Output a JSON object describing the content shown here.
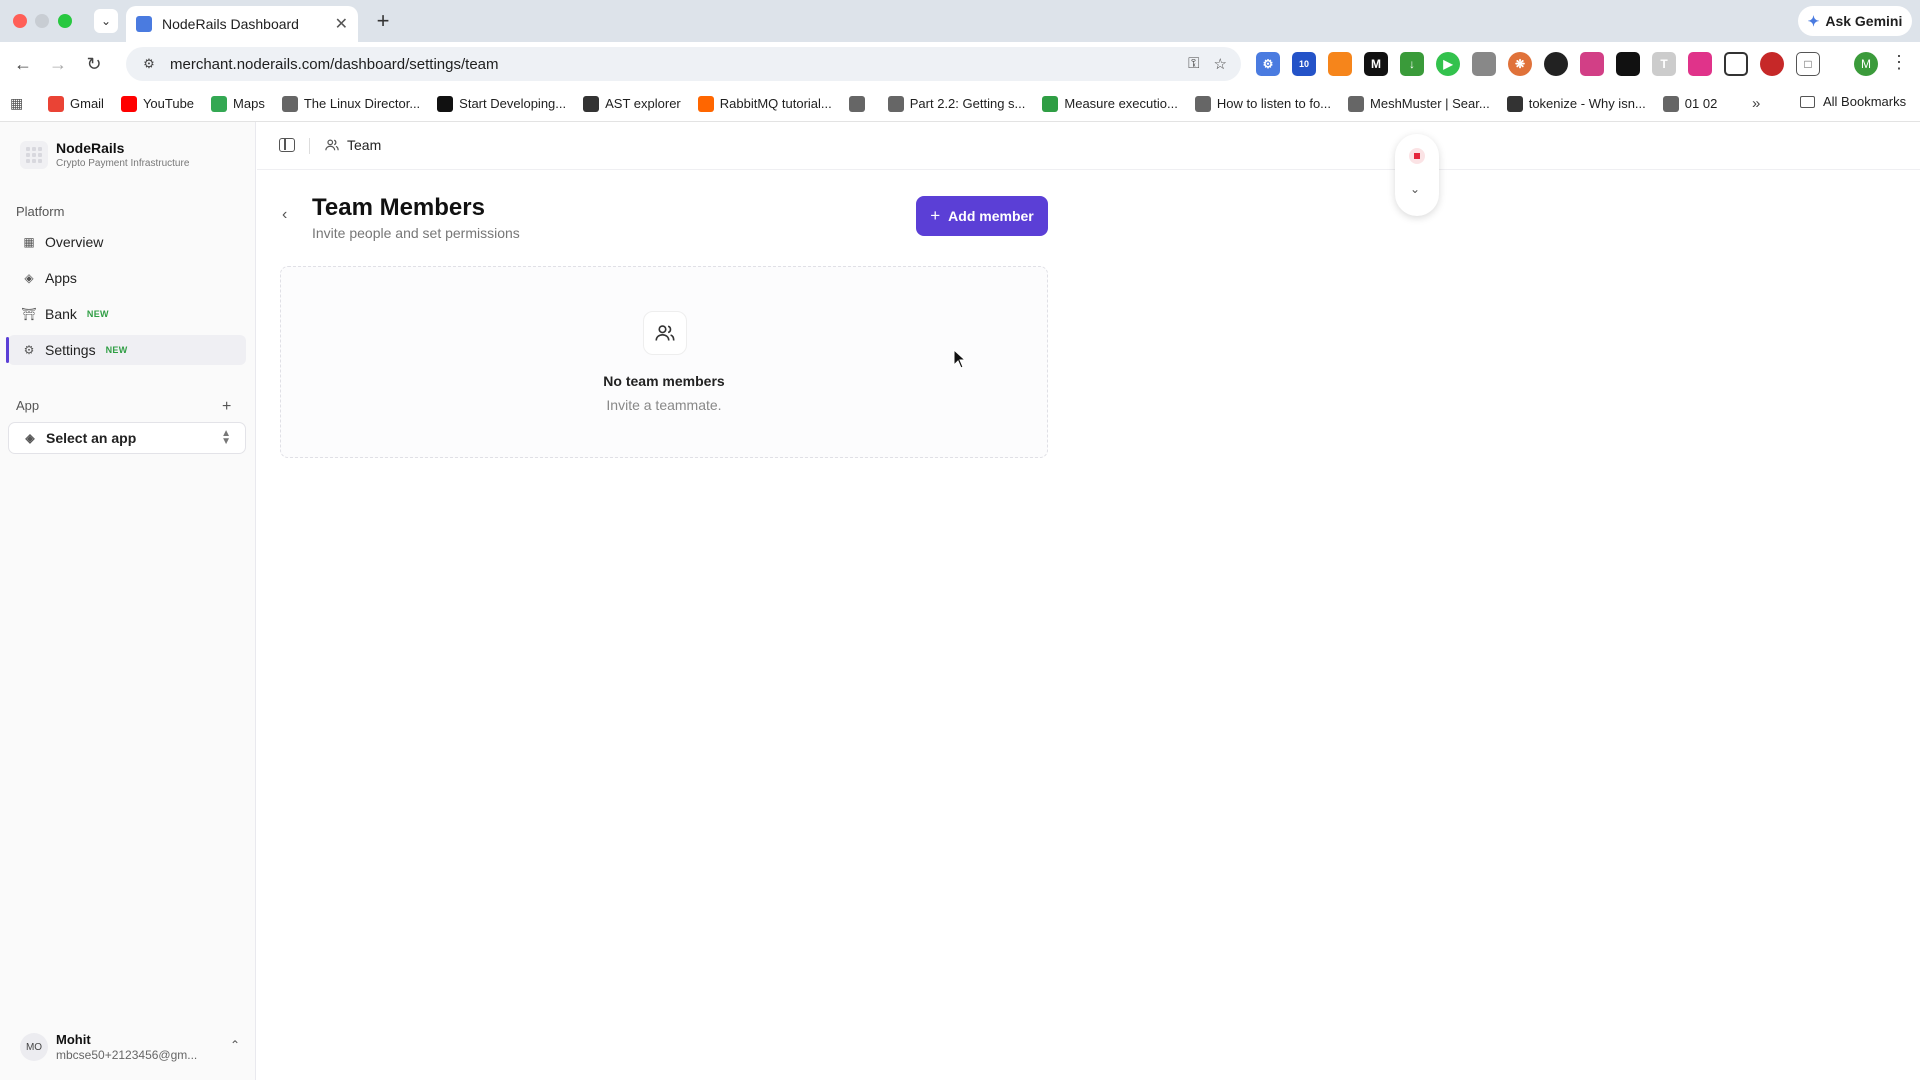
{
  "browser": {
    "tab_title": "NodeRails Dashboard",
    "url": "merchant.noderails.com/dashboard/settings/team",
    "gemini_label": "Ask Gemini",
    "profile_initial": "M",
    "ext_badge": "10",
    "bookmarks": [
      {
        "label": "Gmail",
        "icon": "gmail-icon",
        "color": "#ea4335"
      },
      {
        "label": "YouTube",
        "icon": "youtube-icon",
        "color": "#ff0000"
      },
      {
        "label": "Maps",
        "icon": "maps-icon",
        "color": "#34a853"
      },
      {
        "label": "The Linux Director...",
        "icon": "globe-icon",
        "color": "#666666"
      },
      {
        "label": "Start Developing...",
        "icon": "medium-icon",
        "color": "#111111"
      },
      {
        "label": "AST explorer",
        "icon": "ast-icon",
        "color": "#333333"
      },
      {
        "label": "RabbitMQ tutorial...",
        "icon": "rabbitmq-icon",
        "color": "#ff6600"
      },
      {
        "label": "",
        "icon": "globe-icon",
        "color": "#666666"
      },
      {
        "label": "Part 2.2: Getting s...",
        "icon": "globe-icon",
        "color": "#666666"
      },
      {
        "label": "Measure executio...",
        "icon": "link-icon",
        "color": "#2f9e44"
      },
      {
        "label": "How to listen to fo...",
        "icon": "globe-icon",
        "color": "#666666"
      },
      {
        "label": "MeshMuster | Sear...",
        "icon": "globe-icon",
        "color": "#666666"
      },
      {
        "label": "tokenize - Why isn...",
        "icon": "stack-icon",
        "color": "#333333"
      },
      {
        "label": "01 02",
        "icon": "globe-icon",
        "color": "#666666"
      }
    ],
    "all_bookmarks_label": "All Bookmarks"
  },
  "sidebar": {
    "brand_name": "NodeRails",
    "brand_sub": "Crypto Payment Infrastructure",
    "platform_label": "Platform",
    "items": [
      {
        "label": "Overview",
        "icon": "grid-icon",
        "badge": ""
      },
      {
        "label": "Apps",
        "icon": "layers-icon",
        "badge": ""
      },
      {
        "label": "Bank",
        "icon": "bank-icon",
        "badge": "NEW"
      },
      {
        "label": "Settings",
        "icon": "gear-icon",
        "badge": "NEW"
      }
    ],
    "app_label": "App",
    "select_app": "Select an app",
    "user": {
      "initials": "MO",
      "name": "Mohit",
      "email": "mbcse50+2123456@gm..."
    }
  },
  "topbar": {
    "crumb": "Team"
  },
  "main": {
    "title": "Team Members",
    "subtitle": "Invite people and set permissions",
    "add_button": "Add member",
    "empty_title": "No team members",
    "empty_sub": "Invite a teammate."
  },
  "colors": {
    "accent": "#5b3fd6",
    "new_badge": "#2f9e44",
    "record": "#e5253b"
  }
}
